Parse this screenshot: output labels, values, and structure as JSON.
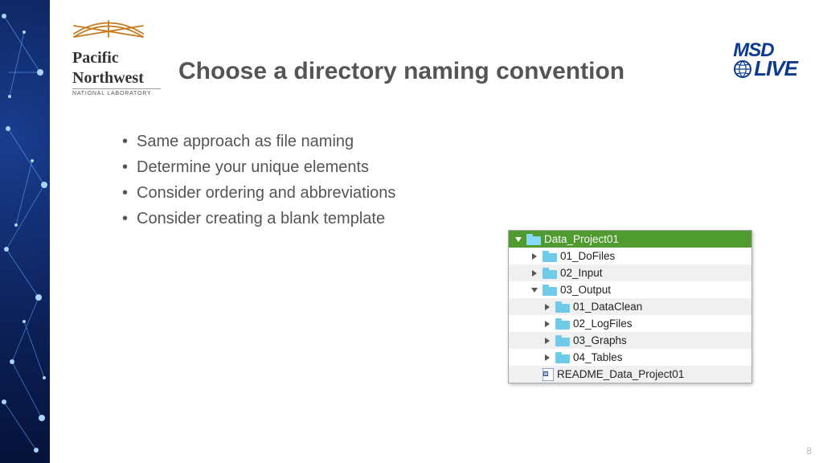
{
  "logo_left": {
    "line1": "Pacific",
    "line2": "Northwest",
    "sub": "NATIONAL LABORATORY"
  },
  "logo_right": {
    "top": "MSD",
    "bottom": "LIVE"
  },
  "title": "Choose a directory naming convention",
  "bullets": [
    "Same approach as file naming",
    "Determine your unique elements",
    "Consider ordering and abbreviations",
    "Consider creating a blank template"
  ],
  "tree": {
    "root": "Data_Project01",
    "children": [
      {
        "label": "01_DoFiles",
        "expanded": false
      },
      {
        "label": "02_Input",
        "expanded": false
      },
      {
        "label": "03_Output",
        "expanded": true,
        "children": [
          {
            "label": "01_DataClean"
          },
          {
            "label": "02_LogFiles"
          },
          {
            "label": "03_Graphs"
          },
          {
            "label": "04_Tables"
          }
        ]
      }
    ],
    "file": "README_Data_Project01"
  },
  "page_number": "8"
}
